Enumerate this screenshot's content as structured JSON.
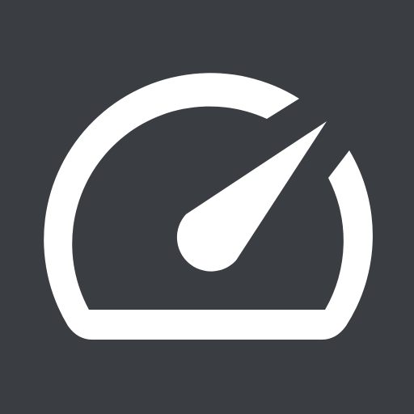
{
  "icon": {
    "name": "speedometer-icon",
    "background_color": "#3a3d41",
    "foreground_color": "#ffffff"
  }
}
